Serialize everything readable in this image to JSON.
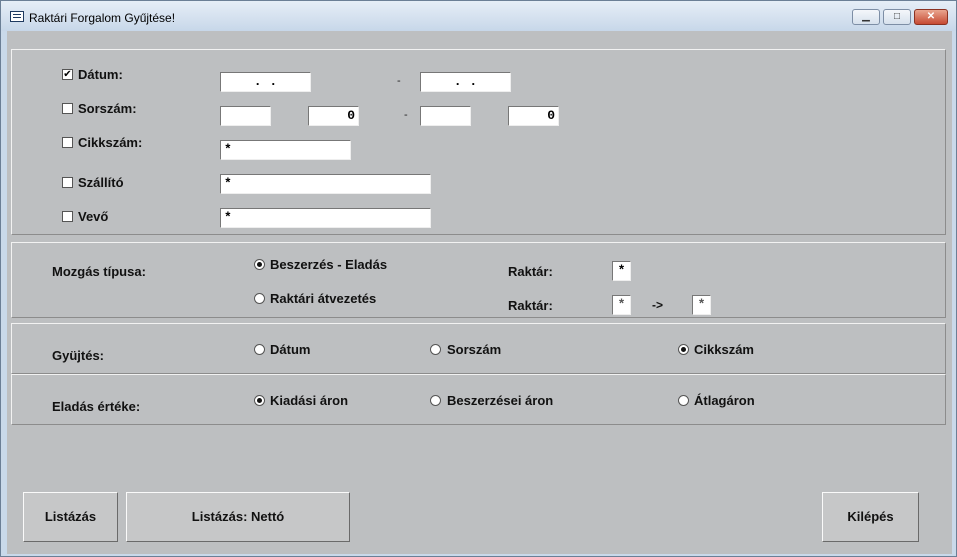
{
  "window": {
    "title": "Raktári Forgalom Gyűjtése!",
    "controls": {
      "minimize": "▁",
      "maximize": "□",
      "close": "✕"
    }
  },
  "filters": {
    "datum": {
      "label": "Dátum:",
      "checked": true,
      "from": " .  .",
      "to": " .  .",
      "separator": "-"
    },
    "sorszam": {
      "label": "Sorszám:",
      "checked": false,
      "from_a": "",
      "from_b": "0",
      "to_a": "",
      "to_b": "0",
      "separator": "-"
    },
    "cikkszam": {
      "label": "Cikkszám:",
      "checked": false,
      "value": "*"
    },
    "szallito": {
      "label": "Szállító",
      "checked": false,
      "value": "*"
    },
    "vevo": {
      "label": "Vevő",
      "checked": false,
      "value": "*"
    }
  },
  "movement": {
    "label": "Mozgás típusa:",
    "option1": "Beszerzés - Eladás",
    "option2": "Raktári átvezetés",
    "selected": "option1",
    "raktar_label": "Raktár:",
    "raktar_value": "*",
    "raktar2_label": "Raktár:",
    "raktar_from": "*",
    "arrow": "->",
    "raktar_to": "*"
  },
  "gyujtes": {
    "label": "Gyüjtés:",
    "options": [
      "Dátum",
      "Sorszám",
      "Cikkszám"
    ],
    "selected": "Cikkszám"
  },
  "eladas": {
    "label": "Eladás értéke:",
    "options": [
      "Kiadási áron",
      "Beszerzései áron",
      "Átlagáron"
    ],
    "selected": "Kiadási áron"
  },
  "buttons": {
    "listazas": "Listázás",
    "listazas_netto": "Listázás: Nettó",
    "kilepes": "Kilépés"
  },
  "colors": {
    "face": "#bdbfc1",
    "title_bg": "#c9d9ea",
    "close": "#c64a33"
  }
}
